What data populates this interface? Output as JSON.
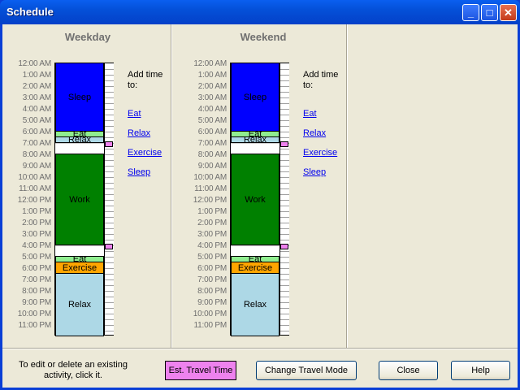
{
  "window": {
    "title": "Schedule"
  },
  "hours": [
    "12:00 AM",
    "1:00 AM",
    "2:00 AM",
    "3:00 AM",
    "4:00 AM",
    "5:00 AM",
    "6:00 AM",
    "7:00 AM",
    "8:00 AM",
    "9:00 AM",
    "10:00 AM",
    "11:00 AM",
    "12:00 PM",
    "1:00 PM",
    "2:00 PM",
    "3:00 PM",
    "4:00 PM",
    "5:00 PM",
    "6:00 PM",
    "7:00 PM",
    "8:00 PM",
    "9:00 PM",
    "10:00 PM",
    "11:00 PM"
  ],
  "panels": [
    {
      "title": "Weekday",
      "activities": [
        {
          "label": "Sleep",
          "start": 0,
          "end": 6,
          "color": "#0000ff"
        },
        {
          "label": "Eat",
          "start": 6,
          "end": 6.5,
          "color": "#90ee90"
        },
        {
          "label": "Relax",
          "start": 6.5,
          "end": 7,
          "color": "#add8e6"
        },
        {
          "label": "Work",
          "start": 8,
          "end": 16,
          "color": "#008000"
        },
        {
          "label": "Eat",
          "start": 17,
          "end": 17.5,
          "color": "#90ee90"
        },
        {
          "label": "Exercise",
          "start": 17.5,
          "end": 18.5,
          "color": "#ffa500"
        },
        {
          "label": "Relax",
          "start": 18.5,
          "end": 24,
          "color": "#add8e6"
        }
      ],
      "travel": [
        7,
        16
      ]
    },
    {
      "title": "Weekend",
      "activities": [
        {
          "label": "Sleep",
          "start": 0,
          "end": 6,
          "color": "#0000ff"
        },
        {
          "label": "Eat",
          "start": 6,
          "end": 6.5,
          "color": "#90ee90"
        },
        {
          "label": "Relax",
          "start": 6.5,
          "end": 7,
          "color": "#add8e6"
        },
        {
          "label": "Work",
          "start": 8,
          "end": 16,
          "color": "#008000"
        },
        {
          "label": "Eat",
          "start": 17,
          "end": 17.5,
          "color": "#90ee90"
        },
        {
          "label": "Exercise",
          "start": 17.5,
          "end": 18.5,
          "color": "#ffa500"
        },
        {
          "label": "Relax",
          "start": 18.5,
          "end": 24,
          "color": "#add8e6"
        }
      ],
      "travel": [
        7,
        16
      ]
    }
  ],
  "add_time": {
    "label": "Add time to:",
    "links": [
      "Eat",
      "Relax",
      "Exercise",
      "Sleep"
    ]
  },
  "footer": {
    "hint": "To edit or delete an existing activity, click it.",
    "travel_time": "Est. Travel Time",
    "travel_mode": "Change Travel Mode",
    "close": "Close",
    "help": "Help"
  },
  "colors": {
    "travel_marker": "#ee82ee"
  }
}
